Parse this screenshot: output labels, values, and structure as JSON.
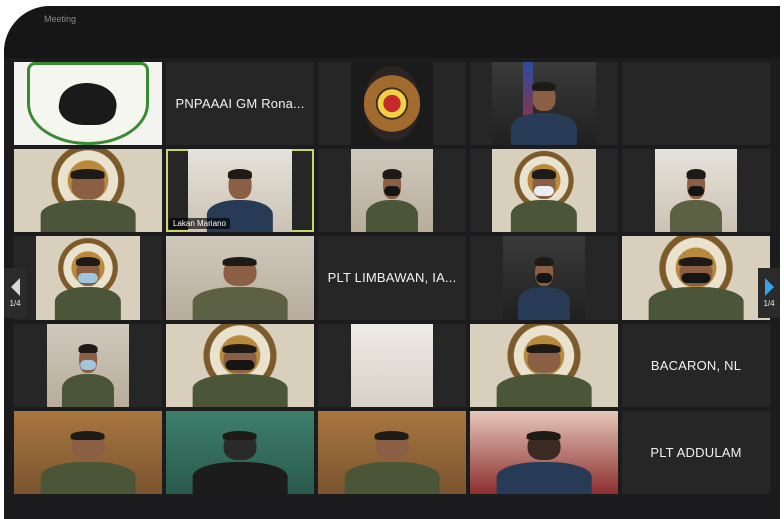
{
  "window": {
    "title": "Meeting"
  },
  "pagination": {
    "left": "1/4",
    "right": "1/4"
  },
  "tiles": [
    {
      "name": ""
    },
    {
      "name": "PNPAAAI GM Rona..."
    },
    {
      "name": ""
    },
    {
      "name": ""
    },
    {
      "name": ""
    },
    {
      "name": ""
    },
    {
      "name": "Lakan Mariano"
    },
    {
      "name": ""
    },
    {
      "name": ""
    },
    {
      "name": ""
    },
    {
      "name": ""
    },
    {
      "name": ""
    },
    {
      "name": "PLT LIMBAWAN, IA..."
    },
    {
      "name": ""
    },
    {
      "name": ""
    },
    {
      "name": ""
    },
    {
      "name": ""
    },
    {
      "name": ""
    },
    {
      "name": ""
    },
    {
      "name": "BACARON, NL"
    },
    {
      "name": ""
    },
    {
      "name": ""
    },
    {
      "name": ""
    },
    {
      "name": ""
    },
    {
      "name": "PLT ADDULAM"
    }
  ]
}
